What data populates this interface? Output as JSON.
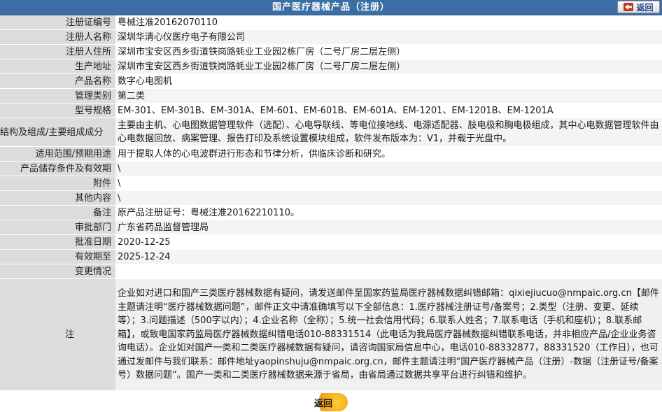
{
  "header": {
    "title": "国产医疗器械产品（注册）",
    "back_label": "返回"
  },
  "rows": [
    {
      "key": "注册证编号",
      "value": "粤械注准20162070110"
    },
    {
      "key": "注册人名称",
      "value": "深圳华清心仪医疗电子有限公司"
    },
    {
      "key": "注册人住所",
      "value": "深圳市宝安区西乡街道铁岗路蚝业工业园2栋厂房（二号厂房二层左侧）"
    },
    {
      "key": "生产地址",
      "value": "深圳市宝安区西乡街道铁岗路蚝业工业园2栋厂房（二号厂房二层左侧）"
    },
    {
      "key": "产品名称",
      "value": "数字心电图机"
    },
    {
      "key": "管理类别",
      "value": "第二类"
    },
    {
      "key": "型号规格",
      "value": "EM-301、EM-301B、EM-301A、EM-601、EM-601B、EM-601A、EM-1201、EM-1201B、EM-1201A"
    },
    {
      "key": "结构及组成/主要组成成分",
      "value": "主要由主机、心电图数据管理软件（选配）、心电导联线、等电位接地线、电源适配器、肢电极和胸电极组成，其中心电数据管理软件由心电数据回放、病案管理、报告打印及系统设置模块组成，软件发布版本为：V1，并载于光盘中。"
    },
    {
      "key": "适用范围/预期用途",
      "value": "用于提取人体的心电波群进行形态和节律分析，供临床诊断和研究。"
    },
    {
      "key": "产品储存条件及有效期",
      "value": "\\"
    },
    {
      "key": "附件",
      "value": "\\"
    },
    {
      "key": "其他内容",
      "value": "\\"
    },
    {
      "key": "备注",
      "value": "原产品注册证号：粤械注准20162210110。"
    },
    {
      "key": "审批部门",
      "value": "广东省药品监督管理局"
    },
    {
      "key": "批准日期",
      "value": "2020-12-25"
    },
    {
      "key": "有效期至",
      "value": "2025-12-24"
    },
    {
      "key": "变更情况",
      "value": ""
    }
  ],
  "note": {
    "key": "注",
    "text": "企业如对进口和国产三类医疗器械数据有疑问，请发送邮件至国家药监局医疗器械数据纠错邮箱：qixiejiucuo@nmpaic.org.cn【邮件主题请注明“医疗器械数据问题”，邮件正文中请准确填写以下全部信息：1.医疗器械注册证号/备案号；2.类型（注册、变更、延续等）；3.问题描述（500字以内）；4.企业名称（全称）；5.统一社会信用代码；6.联系人姓名；7.联系电话（手机和座机）；8.联系邮箱】，或致电国家药监局医疗器械数据纠错电话010-88331514（此电话为我局医疗器械数据纠错联系电话，并非相应产品/企业业务咨询电话）。企业如对国产一类和二类医疗器械数据有疑问，请咨询国家局信息中心，电话010-88332877，88331520（工作日），也可通过发邮件与我们联系：邮件地址yaopinshuju@nmpaic.org.cn，邮件主题请注明“国产医疗器械产品（注册）-数据（注册证号/备案号）数据问题”。国产一类和二类医疗器械数据来源于省局，由省局通过数据共享平台进行纠错和维护。"
  },
  "footer": {
    "back_label": "返回"
  }
}
